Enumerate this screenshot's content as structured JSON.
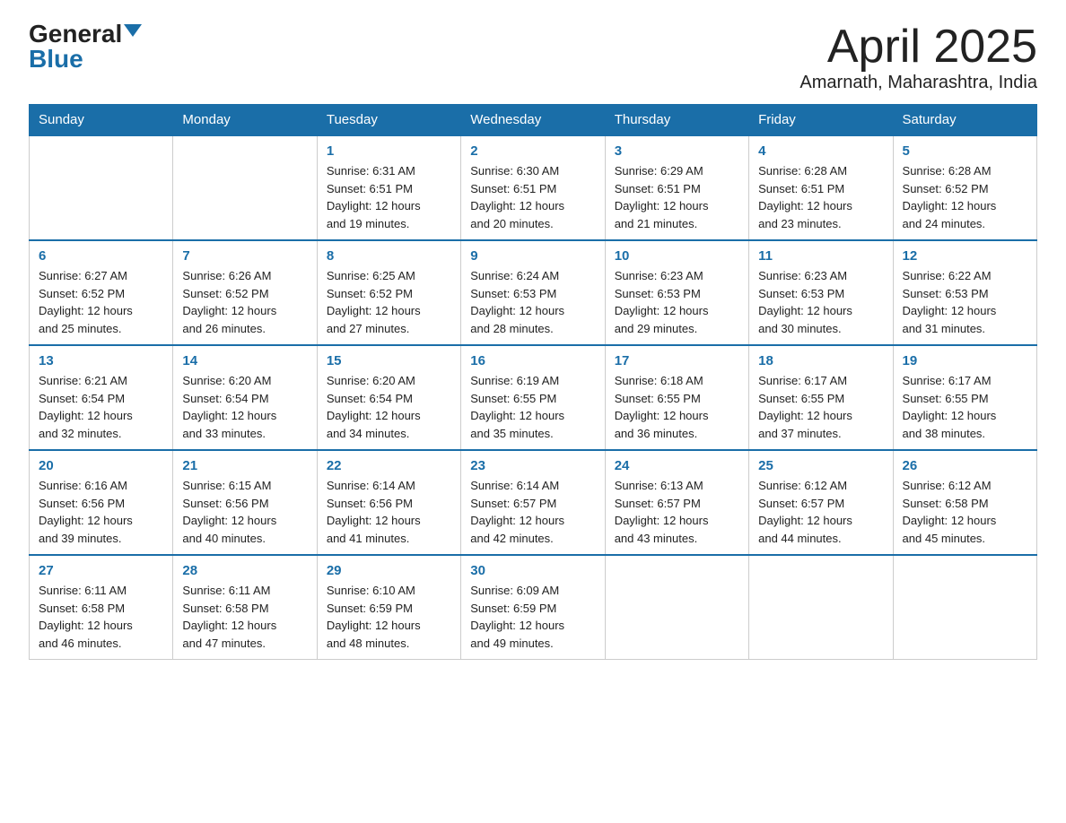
{
  "logo": {
    "general": "General",
    "blue": "Blue"
  },
  "title": {
    "month_year": "April 2025",
    "location": "Amarnath, Maharashtra, India"
  },
  "header_days": [
    "Sunday",
    "Monday",
    "Tuesday",
    "Wednesday",
    "Thursday",
    "Friday",
    "Saturday"
  ],
  "weeks": [
    [
      {
        "day": "",
        "info": ""
      },
      {
        "day": "",
        "info": ""
      },
      {
        "day": "1",
        "info": "Sunrise: 6:31 AM\nSunset: 6:51 PM\nDaylight: 12 hours\nand 19 minutes."
      },
      {
        "day": "2",
        "info": "Sunrise: 6:30 AM\nSunset: 6:51 PM\nDaylight: 12 hours\nand 20 minutes."
      },
      {
        "day": "3",
        "info": "Sunrise: 6:29 AM\nSunset: 6:51 PM\nDaylight: 12 hours\nand 21 minutes."
      },
      {
        "day": "4",
        "info": "Sunrise: 6:28 AM\nSunset: 6:51 PM\nDaylight: 12 hours\nand 23 minutes."
      },
      {
        "day": "5",
        "info": "Sunrise: 6:28 AM\nSunset: 6:52 PM\nDaylight: 12 hours\nand 24 minutes."
      }
    ],
    [
      {
        "day": "6",
        "info": "Sunrise: 6:27 AM\nSunset: 6:52 PM\nDaylight: 12 hours\nand 25 minutes."
      },
      {
        "day": "7",
        "info": "Sunrise: 6:26 AM\nSunset: 6:52 PM\nDaylight: 12 hours\nand 26 minutes."
      },
      {
        "day": "8",
        "info": "Sunrise: 6:25 AM\nSunset: 6:52 PM\nDaylight: 12 hours\nand 27 minutes."
      },
      {
        "day": "9",
        "info": "Sunrise: 6:24 AM\nSunset: 6:53 PM\nDaylight: 12 hours\nand 28 minutes."
      },
      {
        "day": "10",
        "info": "Sunrise: 6:23 AM\nSunset: 6:53 PM\nDaylight: 12 hours\nand 29 minutes."
      },
      {
        "day": "11",
        "info": "Sunrise: 6:23 AM\nSunset: 6:53 PM\nDaylight: 12 hours\nand 30 minutes."
      },
      {
        "day": "12",
        "info": "Sunrise: 6:22 AM\nSunset: 6:53 PM\nDaylight: 12 hours\nand 31 minutes."
      }
    ],
    [
      {
        "day": "13",
        "info": "Sunrise: 6:21 AM\nSunset: 6:54 PM\nDaylight: 12 hours\nand 32 minutes."
      },
      {
        "day": "14",
        "info": "Sunrise: 6:20 AM\nSunset: 6:54 PM\nDaylight: 12 hours\nand 33 minutes."
      },
      {
        "day": "15",
        "info": "Sunrise: 6:20 AM\nSunset: 6:54 PM\nDaylight: 12 hours\nand 34 minutes."
      },
      {
        "day": "16",
        "info": "Sunrise: 6:19 AM\nSunset: 6:55 PM\nDaylight: 12 hours\nand 35 minutes."
      },
      {
        "day": "17",
        "info": "Sunrise: 6:18 AM\nSunset: 6:55 PM\nDaylight: 12 hours\nand 36 minutes."
      },
      {
        "day": "18",
        "info": "Sunrise: 6:17 AM\nSunset: 6:55 PM\nDaylight: 12 hours\nand 37 minutes."
      },
      {
        "day": "19",
        "info": "Sunrise: 6:17 AM\nSunset: 6:55 PM\nDaylight: 12 hours\nand 38 minutes."
      }
    ],
    [
      {
        "day": "20",
        "info": "Sunrise: 6:16 AM\nSunset: 6:56 PM\nDaylight: 12 hours\nand 39 minutes."
      },
      {
        "day": "21",
        "info": "Sunrise: 6:15 AM\nSunset: 6:56 PM\nDaylight: 12 hours\nand 40 minutes."
      },
      {
        "day": "22",
        "info": "Sunrise: 6:14 AM\nSunset: 6:56 PM\nDaylight: 12 hours\nand 41 minutes."
      },
      {
        "day": "23",
        "info": "Sunrise: 6:14 AM\nSunset: 6:57 PM\nDaylight: 12 hours\nand 42 minutes."
      },
      {
        "day": "24",
        "info": "Sunrise: 6:13 AM\nSunset: 6:57 PM\nDaylight: 12 hours\nand 43 minutes."
      },
      {
        "day": "25",
        "info": "Sunrise: 6:12 AM\nSunset: 6:57 PM\nDaylight: 12 hours\nand 44 minutes."
      },
      {
        "day": "26",
        "info": "Sunrise: 6:12 AM\nSunset: 6:58 PM\nDaylight: 12 hours\nand 45 minutes."
      }
    ],
    [
      {
        "day": "27",
        "info": "Sunrise: 6:11 AM\nSunset: 6:58 PM\nDaylight: 12 hours\nand 46 minutes."
      },
      {
        "day": "28",
        "info": "Sunrise: 6:11 AM\nSunset: 6:58 PM\nDaylight: 12 hours\nand 47 minutes."
      },
      {
        "day": "29",
        "info": "Sunrise: 6:10 AM\nSunset: 6:59 PM\nDaylight: 12 hours\nand 48 minutes."
      },
      {
        "day": "30",
        "info": "Sunrise: 6:09 AM\nSunset: 6:59 PM\nDaylight: 12 hours\nand 49 minutes."
      },
      {
        "day": "",
        "info": ""
      },
      {
        "day": "",
        "info": ""
      },
      {
        "day": "",
        "info": ""
      }
    ]
  ]
}
